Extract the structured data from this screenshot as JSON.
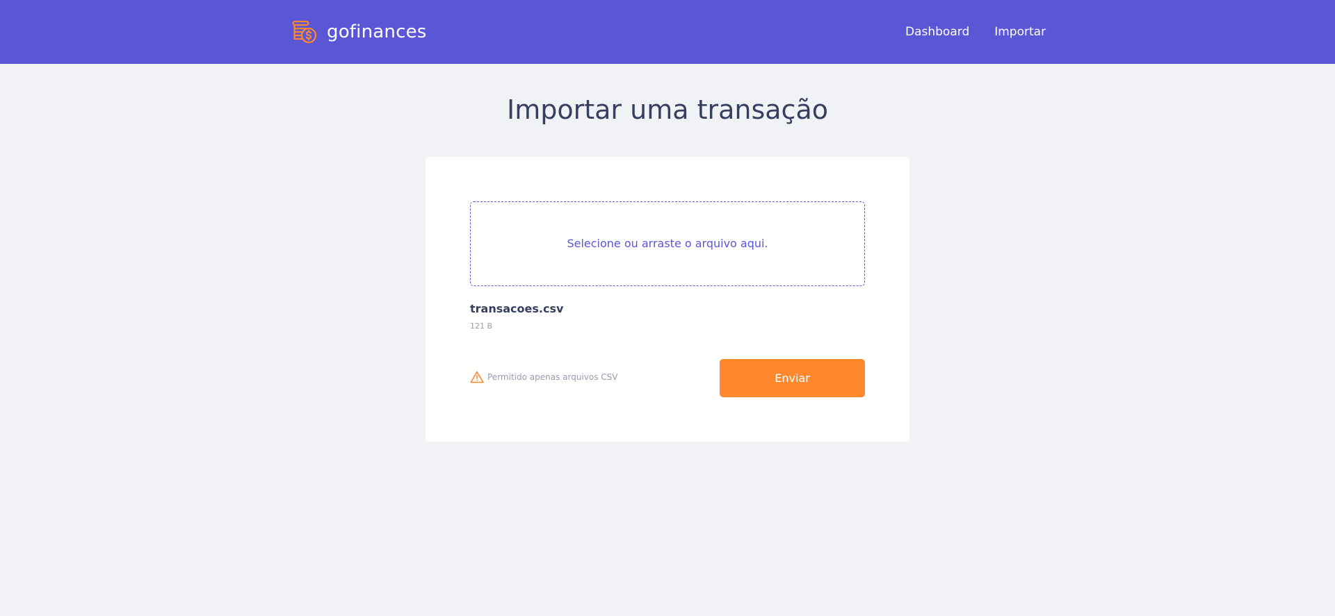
{
  "header": {
    "logo_icon": "coins-dollar-icon",
    "app_name": "gofinances",
    "nav": [
      {
        "label": "Dashboard"
      },
      {
        "label": "Importar"
      }
    ]
  },
  "page": {
    "title": "Importar uma transação"
  },
  "upload": {
    "dropzone_label": "Selecione ou arraste o arquivo aqui.",
    "file": {
      "name": "transacoes.csv",
      "size": "121 B"
    },
    "notice_icon": "warning-icon",
    "notice": "Permitido apenas arquivos CSV",
    "submit_label": "Enviar"
  },
  "colors": {
    "primary": "#5b56d6",
    "accent": "#ff872c",
    "background": "#f0f2f5",
    "title": "#363f5f",
    "muted": "#969cb3"
  }
}
